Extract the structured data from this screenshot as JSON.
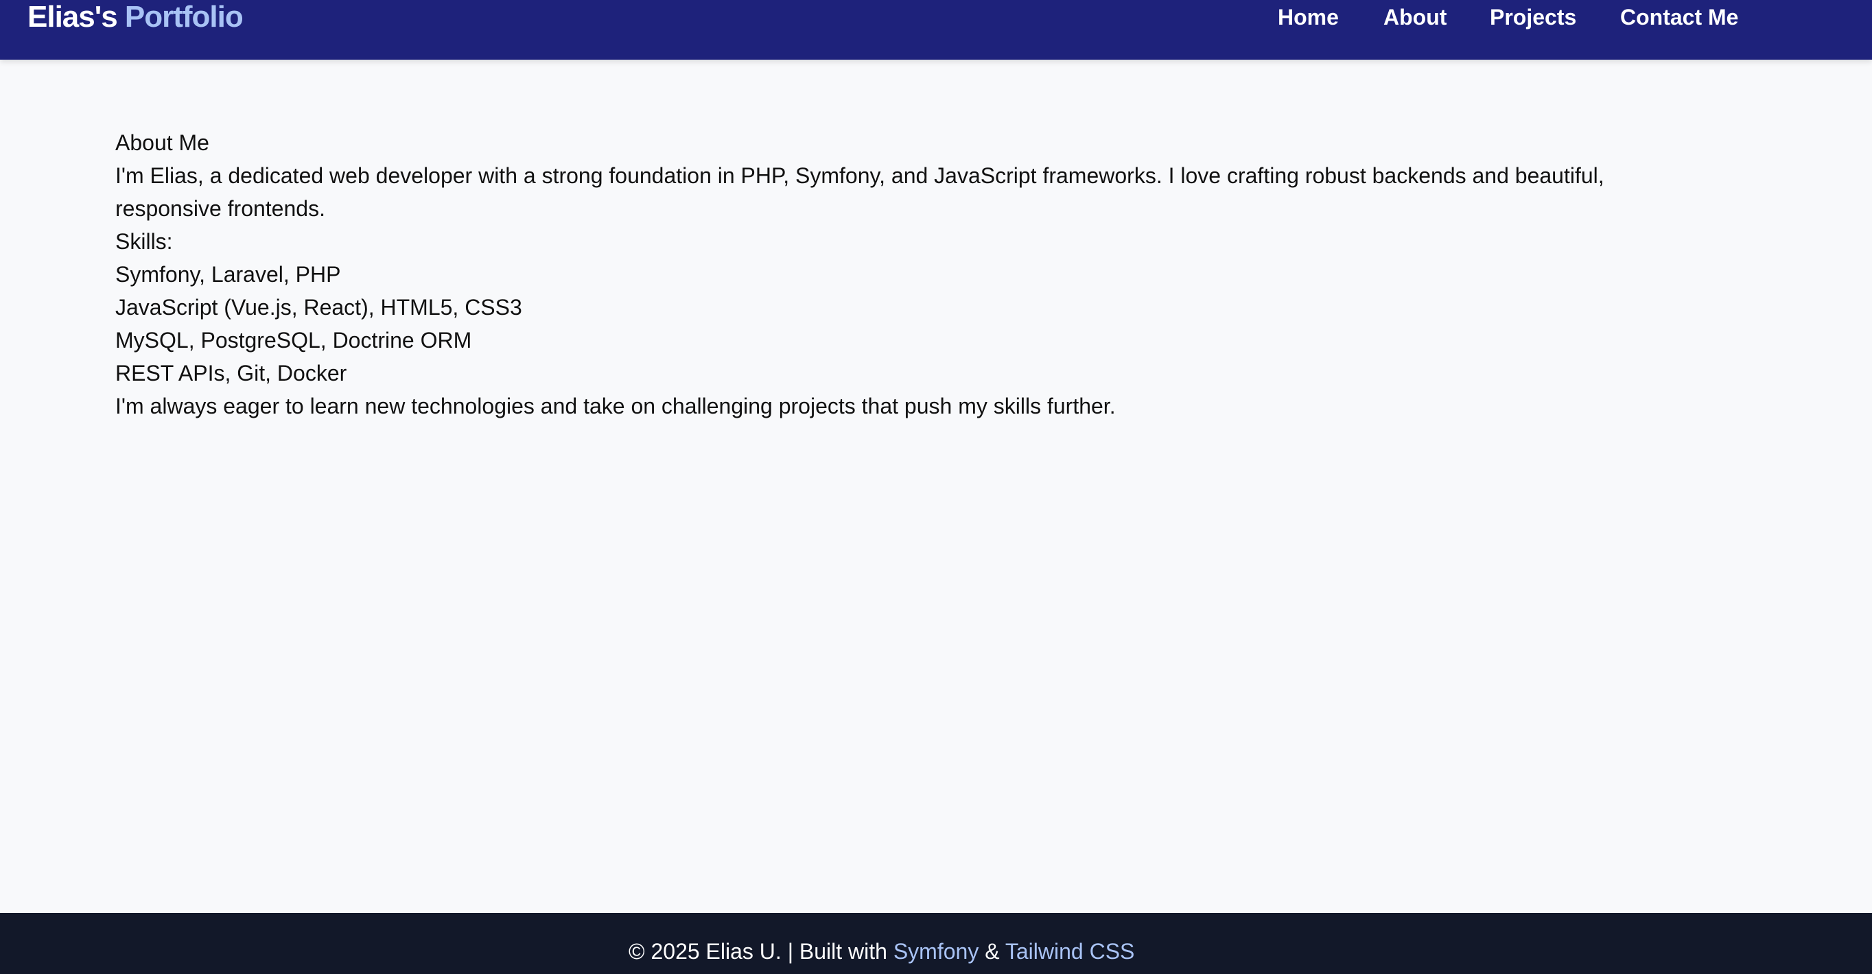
{
  "navbar": {
    "brand_primary": "Elias's",
    "brand_accent": "Portfolio",
    "links": [
      {
        "label": "Home"
      },
      {
        "label": "About"
      },
      {
        "label": "Projects"
      },
      {
        "label": "Contact Me"
      }
    ]
  },
  "main": {
    "heading": "About Me",
    "intro": "I'm Elias, a dedicated web developer with a strong foundation in PHP, Symfony, and JavaScript frameworks. I love crafting robust backends and beautiful, responsive frontends.",
    "skills_label": "Skills:",
    "skills": [
      "Symfony, Laravel, PHP",
      "JavaScript (Vue.js, React), HTML5, CSS3",
      "MySQL, PostgreSQL, Doctrine ORM",
      "REST APIs, Git, Docker"
    ],
    "closing": "I'm always eager to learn new technologies and take on challenging projects that push my skills further."
  },
  "footer": {
    "prefix": "© 2025 Elias U. | Built with",
    "link1": "Symfony",
    "connector": "&",
    "link2": "Tailwind CSS"
  },
  "colors": {
    "navbar_bg": "#1e227b",
    "brand_accent": "#a9c3f5",
    "page_bg": "#f8f9fb",
    "footer_bg": "#121829",
    "footer_link": "#a9c3f5"
  }
}
